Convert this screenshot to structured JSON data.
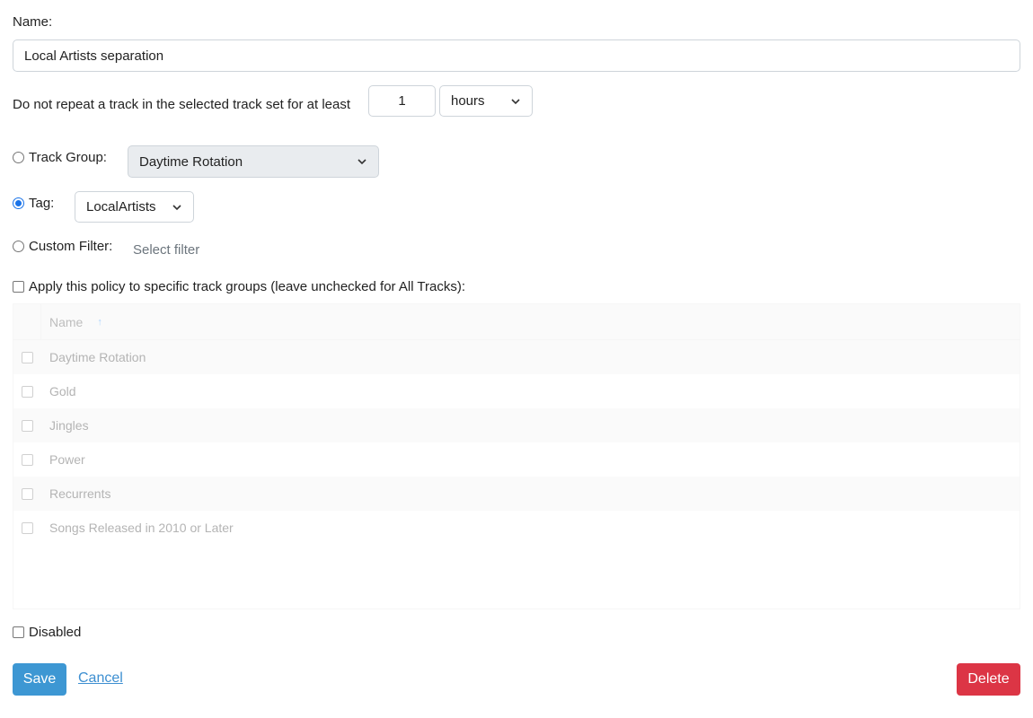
{
  "form": {
    "name_label": "Name:",
    "name_value": "Local Artists separation",
    "repeat_label": "Do not repeat a track in the selected track set for at least",
    "repeat_value": "1",
    "repeat_unit": "hours",
    "track_group_label": "Track Group:",
    "track_group_value": "Daytime Rotation",
    "tag_label": "Tag:",
    "tag_value": "LocalArtists",
    "custom_filter_label": "Custom Filter:",
    "custom_filter_placeholder": "Select filter",
    "selected_option": "Tag",
    "apply_label": "Apply this policy to specific track groups (leave unchecked for All Tracks):",
    "disabled_label": "Disabled"
  },
  "table": {
    "column_name": "Name",
    "sort_icon": "sort-ascending-icon",
    "rows": [
      {
        "name": "Daytime Rotation"
      },
      {
        "name": "Gold"
      },
      {
        "name": "Jingles"
      },
      {
        "name": "Power"
      },
      {
        "name": "Recurrents"
      },
      {
        "name": "Songs Released in 2010 or Later"
      }
    ]
  },
  "actions": {
    "save_label": "Save",
    "cancel_label": "Cancel",
    "delete_label": "Delete"
  },
  "colors": {
    "primary": "#3d97d3",
    "danger": "#dc3545",
    "radio_selected": "#1a73e8"
  }
}
